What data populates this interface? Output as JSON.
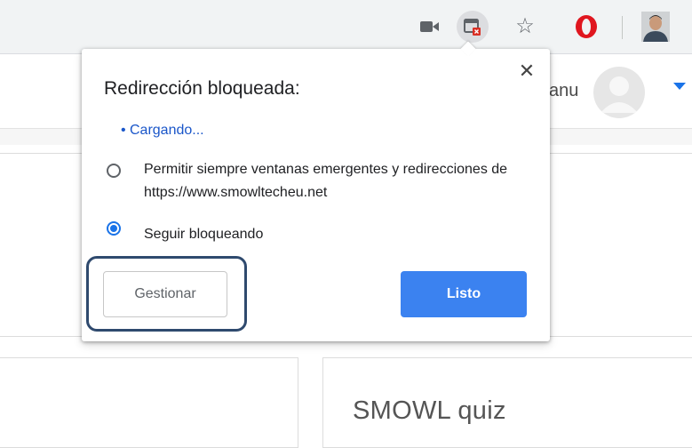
{
  "toolbar": {
    "icons": [
      "camera-icon",
      "popup-blocked-icon",
      "star-icon",
      "opera-icon",
      "profile-photo"
    ]
  },
  "page": {
    "user_name": "anu",
    "quiz_title": "SMOWL quiz"
  },
  "popup": {
    "title": "Redirección bloqueada:",
    "loading_bullet": "•",
    "loading_text": "Cargando...",
    "option_allow": "Permitir siempre ventanas emergentes y redirecciones de https://www.smowltecheu.net",
    "option_block": "Seguir bloqueando",
    "selected_option": "option_block",
    "close_label": "✕",
    "manage_label": "Gestionar",
    "done_label": "Listo"
  },
  "colors": {
    "accent": "#1a73e8",
    "done_button": "#3b82f0",
    "highlight_border": "#2f4a6e",
    "blocked_badge": "#d93025"
  }
}
